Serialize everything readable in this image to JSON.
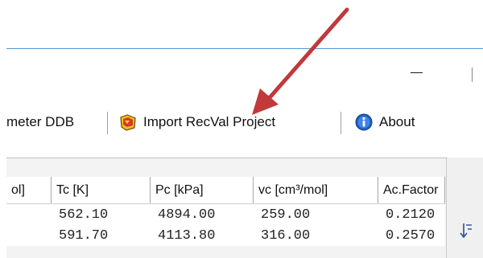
{
  "window": {
    "minimize_glyph": "—"
  },
  "toolbar": {
    "parameter_ddb_label": "meter DDB",
    "import_recval_label": "Import RecVal Project",
    "about_label": "About"
  },
  "grid": {
    "columns": [
      "ol]",
      "Tc [K]",
      "Pc [kPa]",
      "vc [cm³/mol]",
      "Ac.Factor"
    ],
    "rows": [
      [
        "",
        "562.10",
        "4894.00",
        "259.00",
        "0.2120"
      ],
      [
        "",
        "591.70",
        "4113.80",
        "316.00",
        "0.2570"
      ]
    ]
  },
  "colors": {
    "accent_line": "#4a9ad9",
    "arrow": "#c0393b",
    "about_icon": "#1f5fbf"
  },
  "icons": {
    "import": "import-recval-icon",
    "about": "info-icon",
    "side": "sort-icon",
    "annotation": "annotation-arrow"
  }
}
